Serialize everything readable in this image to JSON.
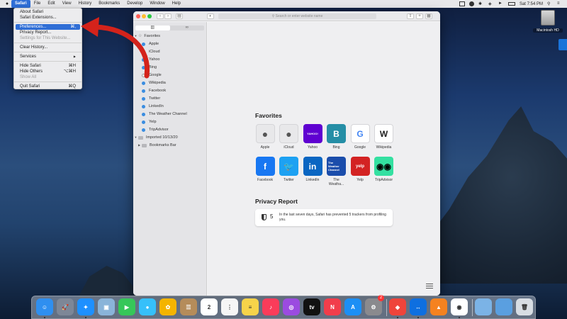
{
  "menubar": {
    "apple": "",
    "items": [
      "Safari",
      "File",
      "Edit",
      "View",
      "History",
      "Bookmarks",
      "Develop",
      "Window",
      "Help"
    ],
    "clock": "Sat 7:54 PM"
  },
  "safari_menu": {
    "items": [
      {
        "label": "About Safari",
        "shortcut": ""
      },
      {
        "label": "Safari Extensions...",
        "shortcut": ""
      },
      {
        "label": "Preferences...",
        "shortcut": "⌘,"
      },
      {
        "label": "Privacy Report...",
        "shortcut": ""
      },
      {
        "label": "Settings for This Website...",
        "shortcut": ""
      },
      {
        "label": "Clear History...",
        "shortcut": ""
      },
      {
        "label": "Services",
        "shortcut": "▶"
      },
      {
        "label": "Hide Safari",
        "shortcut": "⌘H"
      },
      {
        "label": "Hide Others",
        "shortcut": "⌥⌘H"
      },
      {
        "label": "Show All",
        "shortcut": ""
      },
      {
        "label": "Quit Safari",
        "shortcut": "⌘Q"
      }
    ]
  },
  "window": {
    "address_placeholder": "Search or enter website name",
    "sidebar_tabs": [
      "▥",
      "∞"
    ]
  },
  "sidebar": {
    "favorites_label": "Favorites",
    "items": [
      "Apple",
      "iCloud",
      "Yahoo",
      "Bing",
      "Google",
      "Wikipedia",
      "Facebook",
      "Twitter",
      "LinkedIn",
      "The Weather Channel",
      "Yelp",
      "TripAdvisor"
    ],
    "imported_label": "Imported 10/13/20",
    "bookmarks_bar_label": "Bookmarks Bar"
  },
  "start_page": {
    "favorites_title": "Favorites",
    "favorites": [
      {
        "label": "Apple",
        "glyph": "",
        "color": "#e8e8ea",
        "fg": "#555"
      },
      {
        "label": "iCloud",
        "glyph": "",
        "color": "#e8e8ea",
        "fg": "#555"
      },
      {
        "label": "Yahoo",
        "glyph": "YAHOO!",
        "color": "#5f01d1",
        "fg": "#fff"
      },
      {
        "label": "Bing",
        "glyph": "B",
        "color": "#258ea6",
        "fg": "#fff"
      },
      {
        "label": "Google",
        "glyph": "G",
        "color": "#ffffff",
        "fg": "#4285f4"
      },
      {
        "label": "Wikipedia",
        "glyph": "W",
        "color": "#ffffff",
        "fg": "#222"
      },
      {
        "label": "Facebook",
        "glyph": "f",
        "color": "#1877f2",
        "fg": "#fff"
      },
      {
        "label": "Twitter",
        "glyph": "🐦",
        "color": "#1da1f2",
        "fg": "#fff"
      },
      {
        "label": "LinkedIn",
        "glyph": "in",
        "color": "#0a66c2",
        "fg": "#fff"
      },
      {
        "label": "The Weatha...",
        "glyph": "The Weather Channel",
        "color": "#1b4dab",
        "fg": "#fff"
      },
      {
        "label": "Yelp",
        "glyph": "yelp",
        "color": "#d32323",
        "fg": "#fff"
      },
      {
        "label": "TripAdvisor",
        "glyph": "◉◉",
        "color": "#34e0a1",
        "fg": "#000"
      }
    ],
    "privacy_title": "Privacy Report",
    "privacy_count": "5",
    "privacy_text": "In the last seven days, Safari has prevented 5 trackers from profiling you."
  },
  "desktop": {
    "disk_label": "Macintosh HD"
  },
  "dock": {
    "apps": [
      {
        "name": "finder-icon",
        "color": "#2f8ff0",
        "glyph": "☺"
      },
      {
        "name": "launchpad-icon",
        "color": "#7d8797",
        "glyph": "🚀"
      },
      {
        "name": "safari-icon",
        "color": "#1e90ff",
        "glyph": "✦"
      },
      {
        "name": "preview-icon",
        "color": "#8ab4d9",
        "glyph": "▣"
      },
      {
        "name": "facetime-icon",
        "color": "#36c759",
        "glyph": "▶"
      },
      {
        "name": "messages-icon",
        "color": "#36c0fa",
        "glyph": "●"
      },
      {
        "name": "photos-icon",
        "color": "#f4b400",
        "glyph": "✿"
      },
      {
        "name": "contacts-icon",
        "color": "#b58c5a",
        "glyph": "☰"
      },
      {
        "name": "calendar-icon",
        "color": "#ffffff",
        "glyph": "2"
      },
      {
        "name": "reminders-icon",
        "color": "#f6f6f6",
        "glyph": "⋮"
      },
      {
        "name": "notes-icon",
        "color": "#f7d34a",
        "glyph": "≡"
      },
      {
        "name": "music-icon",
        "color": "#fa3c5a",
        "glyph": "♪"
      },
      {
        "name": "podcasts-icon",
        "color": "#9b4be0",
        "glyph": "◎"
      },
      {
        "name": "apple-tv-icon",
        "color": "#111111",
        "glyph": "tv"
      },
      {
        "name": "news-icon",
        "color": "#f23d4b",
        "glyph": "N"
      },
      {
        "name": "app-store-icon",
        "color": "#1c8ff5",
        "glyph": "A"
      },
      {
        "name": "system-preferences-icon",
        "color": "#8a8a8e",
        "glyph": "⚙"
      },
      {
        "name": "anydesk-icon",
        "color": "#ef443b",
        "glyph": "◆"
      },
      {
        "name": "teamviewer-icon",
        "color": "#0e6fe0",
        "glyph": "↔"
      },
      {
        "name": "vlc-icon",
        "color": "#f58220",
        "glyph": "▲"
      },
      {
        "name": "chrome-icon",
        "color": "#ffffff",
        "glyph": "◉"
      },
      {
        "name": "folder-icon",
        "color": "#7bb3e6",
        "glyph": ""
      },
      {
        "name": "downloads-folder-icon",
        "color": "#5a9fe0",
        "glyph": ""
      },
      {
        "name": "trash-icon",
        "color": "#d8dde3",
        "glyph": "🗑"
      }
    ],
    "system_prefs_badge": "2"
  }
}
